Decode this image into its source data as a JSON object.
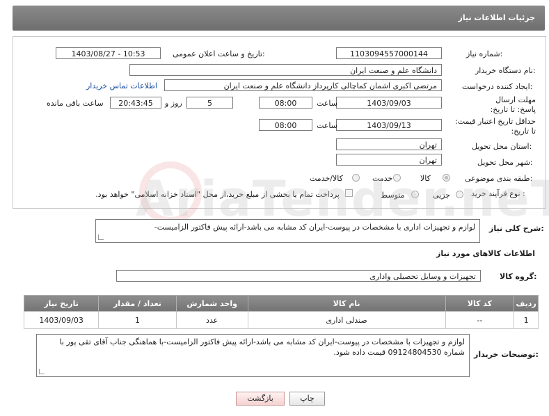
{
  "header": {
    "title": "جزئیات اطلاعات نیاز"
  },
  "need_number": {
    "label": "شماره نیاز:",
    "value": "1103094557000144"
  },
  "announce": {
    "label": "تاریخ و ساعت اعلان عمومی:",
    "value": "1403/08/27 - 10:53"
  },
  "buyer_org": {
    "label": "نام دستگاه خریدار:",
    "value": "دانشگاه علم و صنعت ایران"
  },
  "creator": {
    "label": "ایجاد کننده درخواست:",
    "value": "مرتضی اکبری اشمان کماچالی کارپرداز دانشگاه علم و صنعت ایران",
    "contact_link": "اطلاعات تماس خریدار"
  },
  "reply_deadline": {
    "label": "مهلت ارسال پاسخ: تا تاریخ:",
    "date": "1403/09/03",
    "time_label": "ساعت",
    "time": "08:00",
    "days": "5",
    "days_label": "روز و",
    "remaining": "20:43:45",
    "remaining_label": "ساعت باقی مانده"
  },
  "price_validity": {
    "label": "حداقل تاریخ اعتبار قیمت: تا تاریخ:",
    "date": "1403/09/13",
    "time_label": "ساعت",
    "time": "08:00"
  },
  "delivery_province": {
    "label": "استان محل تحویل:",
    "value": "تهران"
  },
  "delivery_city": {
    "label": "شهر محل تحویل:",
    "value": "تهران"
  },
  "category": {
    "label": "طبقه بندی موضوعی:",
    "options": [
      "کالا",
      "خدمت",
      "کالا/خدمت"
    ],
    "selected": "کالا"
  },
  "purchase_type": {
    "label": "نوع فرآیند خرید :",
    "options": [
      "جزیی",
      "متوسط"
    ],
    "selected": "",
    "payment_note": "پرداخت تمام یا بخشی از مبلغ خرید،از محل \"اسناد خزانه اسلامی\" خواهد بود."
  },
  "description": {
    "label": "شرح کلی نیاز:",
    "value": "لوازم و تجهیزات اداری با مشخصات در پیوست-ایران کد مشابه می باشد-ارائه پیش فاکتور الزامیست-"
  },
  "goods_section": {
    "title": "اطلاعات کالاهای مورد نیاز"
  },
  "goods_group": {
    "label": "گروه کالا:",
    "value": "تجهیزات و وسایل تحصیلی واداری"
  },
  "goods_table": {
    "headers": [
      "ردیف",
      "کد کالا",
      "نام کالا",
      "واحد شمارش",
      "تعداد / مقدار",
      "تاریخ نیاز"
    ],
    "rows": [
      [
        "1",
        "--",
        "صندلی اداری",
        "عدد",
        "1",
        "1403/09/03"
      ]
    ]
  },
  "buyer_notes": {
    "label": "توضیحات خریدار:",
    "value": "لوازم و تجهیزات با مشخصات در پیوست-ایران کد مشابه می باشد-ارائه پیش فاکتور الزامیست-با هماهنگی جناب آقای تقی پور  با شماره 09124804530 قیمت داده شود."
  },
  "buttons": {
    "print": "چاپ",
    "back": "بازگشت"
  },
  "watermark": {
    "text": "AriaTender.neT"
  }
}
